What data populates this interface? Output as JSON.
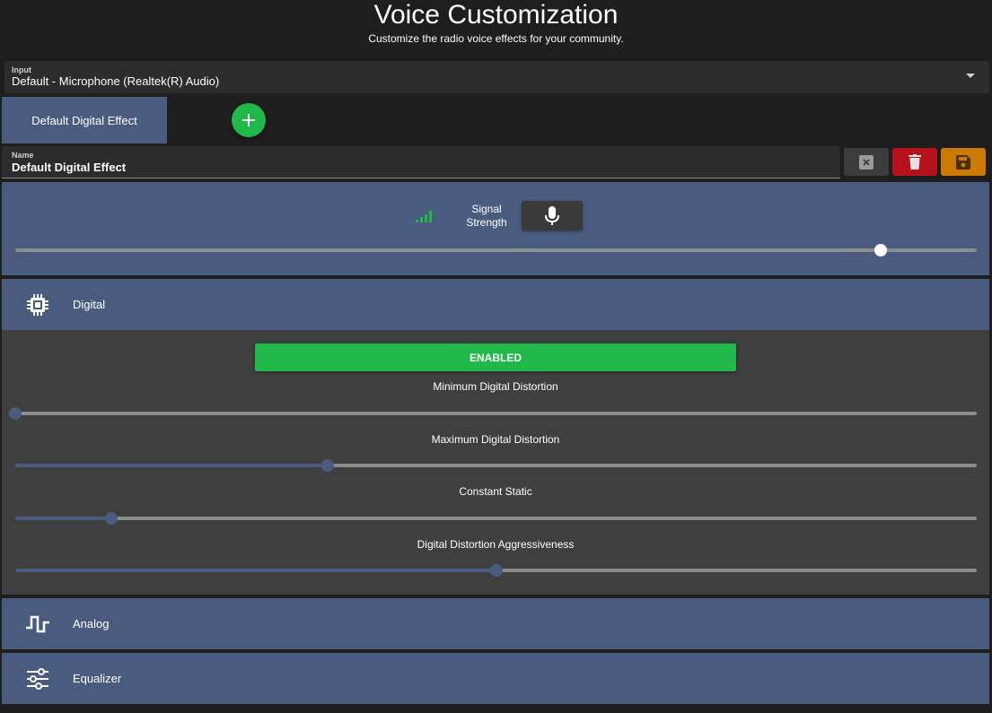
{
  "header": {
    "title": "Voice Customization",
    "subtitle": "Customize the radio voice effects for your community."
  },
  "input": {
    "label": "Input",
    "value": "Default - Microphone (Realtek(R) Audio)"
  },
  "tabs": [
    {
      "label": "Default Digital Effect",
      "active": true
    }
  ],
  "name_field": {
    "label": "Name",
    "value": "Default Digital Effect"
  },
  "actions": {
    "clear_icon": "close-box-icon",
    "delete_icon": "trash-icon",
    "save_icon": "floppy-disk-icon"
  },
  "signal": {
    "label": "Signal Strength",
    "value": 0.9,
    "bars_icon": "signal-bars-icon",
    "mic_icon": "microphone-icon"
  },
  "sections": {
    "digital": {
      "label": "Digital",
      "icon": "chip-icon",
      "enabled_label": "ENABLED",
      "sliders": [
        {
          "label": "Minimum Digital Distortion",
          "value": 0.0
        },
        {
          "label": "Maximum Digital Distortion",
          "value": 0.325
        },
        {
          "label": "Constant Static",
          "value": 0.1
        },
        {
          "label": "Digital Distortion Aggressiveness",
          "value": 0.5
        }
      ]
    },
    "analog": {
      "label": "Analog",
      "icon": "square-wave-icon"
    },
    "equalizer": {
      "label": "Equalizer",
      "icon": "equalizer-icon"
    }
  },
  "colors": {
    "accent_blue": "#4a5b80",
    "slider_fill": "#4a5b80",
    "green": "#21b84a",
    "red": "#b5121b",
    "orange": "#cc7a00"
  }
}
